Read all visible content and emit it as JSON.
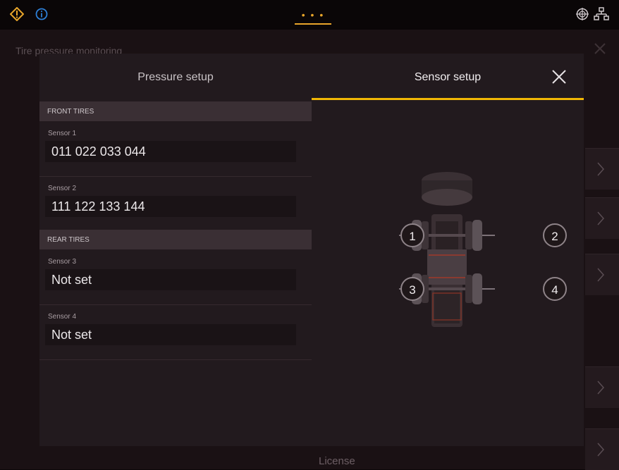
{
  "top_bar": {
    "menu_dots": "• • •",
    "colors": {
      "warning": "#e8a52a",
      "info": "#2d7fd6",
      "accent": "#f1b705"
    },
    "icons": [
      "warning-icon",
      "info-icon",
      "gps-icon",
      "network-icon"
    ]
  },
  "background": {
    "title": "Tire pressure monitoring",
    "license_label": "License"
  },
  "dialog": {
    "tabs": {
      "pressure": "Pressure setup",
      "sensor": "Sensor setup"
    },
    "active_tab": "Sensor setup",
    "front_header": "FRONT TIRES",
    "rear_header": "REAR TIRES",
    "sensors": [
      {
        "label": "Sensor 1",
        "value": "011 022 033 044"
      },
      {
        "label": "Sensor 2",
        "value": "111 122 133 144"
      },
      {
        "label": "Sensor 3",
        "value": "Not set"
      },
      {
        "label": "Sensor 4",
        "value": "Not set"
      }
    ],
    "position_buttons": [
      "1",
      "2",
      "3",
      "4"
    ]
  }
}
